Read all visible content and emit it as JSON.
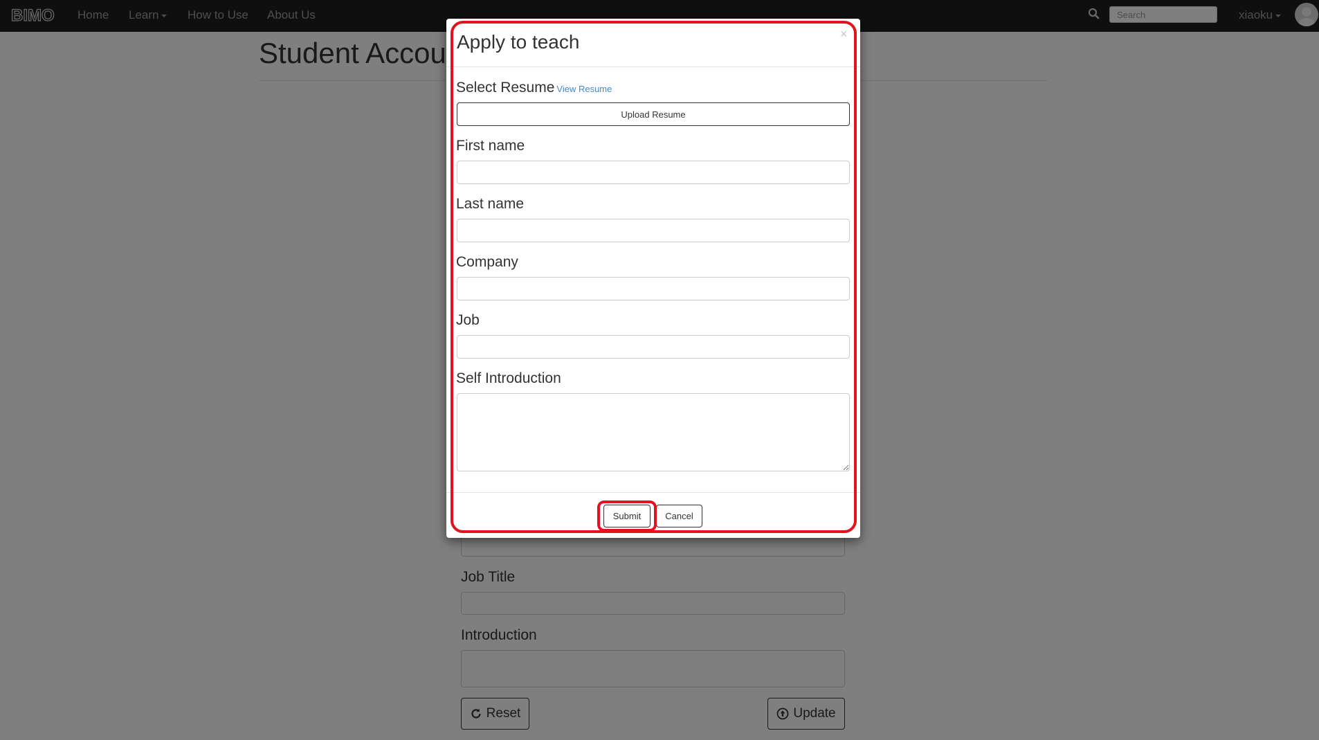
{
  "navbar": {
    "logo_text": "BIMO",
    "items": [
      {
        "label": "Home"
      },
      {
        "label": "Learn"
      },
      {
        "label": "How to Use"
      },
      {
        "label": "About Us"
      }
    ],
    "search_placeholder": "Search",
    "username": "xiaoku"
  },
  "page": {
    "title": "Student Account",
    "fields": [
      {
        "label": "Job Title"
      },
      {
        "label": "Introduction"
      }
    ],
    "reset_label": "Reset",
    "update_label": "Update"
  },
  "modal": {
    "title": "Apply to teach",
    "close_symbol": "×",
    "resume_label": "Select Resume",
    "view_resume_link": "View Resume",
    "upload_button": "Upload Resume",
    "fields": [
      {
        "label": "First name",
        "value": ""
      },
      {
        "label": "Last name",
        "value": ""
      },
      {
        "label": "Company",
        "value": ""
      },
      {
        "label": "Job",
        "value": ""
      }
    ],
    "self_intro_label": "Self Introduction",
    "self_intro_value": "",
    "submit_label": "Submit",
    "cancel_label": "Cancel"
  },
  "colors": {
    "navbar_bg": "#1f1f1f",
    "highlight": "#e0131f",
    "link": "#4a86c5"
  }
}
